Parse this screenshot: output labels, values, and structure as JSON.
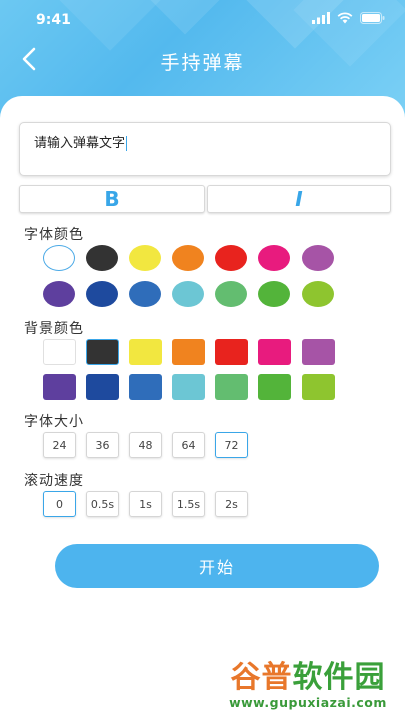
{
  "status_bar": {
    "time": "9:41"
  },
  "nav": {
    "title": "手持弹幕"
  },
  "text_input": {
    "value": "请输入弹幕文字"
  },
  "style_buttons": {
    "bold_label": "B",
    "italic_label": "I"
  },
  "font_color": {
    "label": "字体颜色",
    "colors": [
      "#ffffff",
      "#333333",
      "#f2e740",
      "#f0831f",
      "#e8231e",
      "#e81b7e",
      "#a654a6",
      "#5e3f9e",
      "#1e4a9e",
      "#2f6dba",
      "#6cc6d4",
      "#63bd70",
      "#53b43a",
      "#8ec52f"
    ],
    "selected_index": 0
  },
  "background_color": {
    "label": "背景颜色",
    "colors": [
      "#ffffff",
      "#333333",
      "#f2e740",
      "#f0831f",
      "#e8231e",
      "#e81b7e",
      "#a654a6",
      "#5e3f9e",
      "#1e4a9e",
      "#2f6dba",
      "#6cc6d4",
      "#63bd70",
      "#53b43a",
      "#8ec52f"
    ],
    "selected_index": 1
  },
  "font_size": {
    "label": "字体大小",
    "options": [
      "24",
      "36",
      "48",
      "64",
      "72"
    ],
    "selected_index": 4
  },
  "scroll_speed": {
    "label": "滚动速度",
    "options": [
      "0",
      "0.5s",
      "1s",
      "1.5s",
      "2s"
    ],
    "selected_index": 0
  },
  "start_button": {
    "label": "开始"
  },
  "watermark": {
    "title": "谷普软件园",
    "url": "www.gupuxiazai.com"
  },
  "colors": {
    "accent": "#4db4ee",
    "header_start": "#6cc8f2",
    "header_end": "#7bd0f5"
  }
}
